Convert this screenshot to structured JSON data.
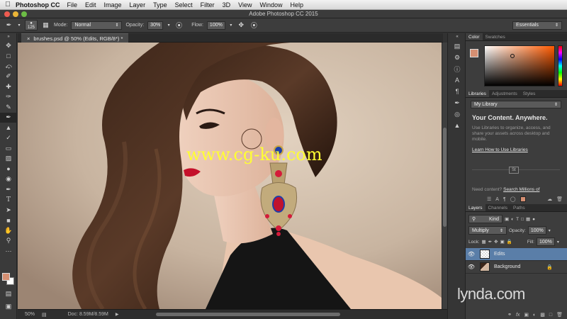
{
  "menubar": {
    "app_name": "Photoshop CC",
    "items": [
      "File",
      "Edit",
      "Image",
      "Layer",
      "Type",
      "Select",
      "Filter",
      "3D",
      "View",
      "Window",
      "Help"
    ]
  },
  "window": {
    "title": "Adobe Photoshop CC 2015"
  },
  "options_bar": {
    "brush_size": "125",
    "mode_label": "Mode:",
    "mode_value": "Normal",
    "opacity_label": "Opacity:",
    "opacity_value": "30%",
    "flow_label": "Flow:",
    "flow_value": "100%",
    "workspace": "Essentials"
  },
  "document": {
    "tab_title": "brushes.psd @ 50% (Edits, RGB/8*) *",
    "zoom": "50%",
    "doc_size": "Doc: 8.59M/8.59M"
  },
  "watermark": "www.cg-ku.com",
  "color_panel": {
    "tabs": [
      "Color",
      "Swatches"
    ],
    "foreground": "#d58f72",
    "background": "#ffffff"
  },
  "libraries_panel": {
    "tabs": [
      "Libraries",
      "Adjustments",
      "Styles"
    ],
    "library": "My Library",
    "heading": "Your Content. Anywhere.",
    "body": "Use Libraries to organize, access, and share your assets across desktop and mobile.",
    "link": "Learn How to Use Libraries",
    "badge": "St",
    "need_text": "Need content?",
    "need_link": "Search Millions of"
  },
  "layers_panel": {
    "tabs": [
      "Layers",
      "Channels",
      "Paths"
    ],
    "filter": "Kind",
    "blend_mode": "Multiply",
    "opacity_label": "Opacity:",
    "opacity_value": "100%",
    "lock_label": "Lock:",
    "fill_label": "Fill:",
    "fill_value": "100%",
    "layers": [
      {
        "name": "Edits",
        "selected": true
      },
      {
        "name": "Background",
        "selected": false
      }
    ]
  },
  "branding": "lynda.com"
}
